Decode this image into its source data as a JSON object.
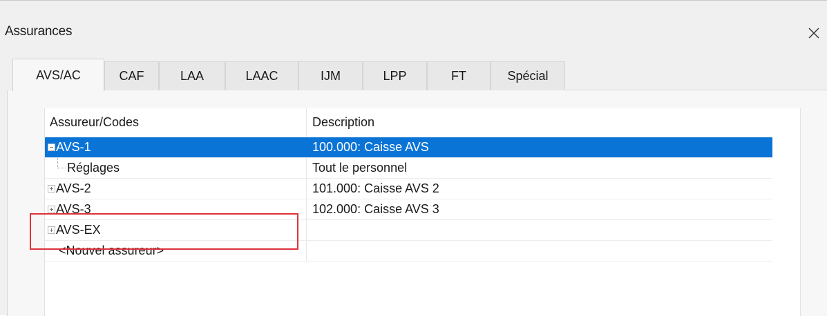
{
  "window": {
    "title": "Assurances",
    "close_icon": "close-icon"
  },
  "tabs": [
    {
      "label": "AVS/AC",
      "active": true
    },
    {
      "label": "CAF",
      "active": false
    },
    {
      "label": "LAA",
      "active": false
    },
    {
      "label": "LAAC",
      "active": false
    },
    {
      "label": "IJM",
      "active": false
    },
    {
      "label": "LPP",
      "active": false
    },
    {
      "label": "FT",
      "active": false
    },
    {
      "label": "Spécial",
      "active": false
    }
  ],
  "tree": {
    "columns": [
      "Assureur/Codes",
      "Description"
    ],
    "rows": [
      {
        "code": "AVS-1",
        "description": "100.000: Caisse AVS",
        "expander": "minus",
        "selected": true
      },
      {
        "code": "Réglages",
        "description": "Tout le personnel",
        "expander": "none",
        "selected": false
      },
      {
        "code": "AVS-2",
        "description": "101.000: Caisse AVS 2",
        "expander": "plus",
        "selected": false
      },
      {
        "code": "AVS-3",
        "description": "102.000: Caisse AVS 3",
        "expander": "plus",
        "selected": false
      },
      {
        "code": "AVS-EX",
        "description": "",
        "expander": "plus",
        "selected": false
      },
      {
        "code": "<Nouvel assureur>",
        "description": "",
        "expander": "none",
        "selected": false
      }
    ]
  },
  "colors": {
    "selection": "#0a74d6",
    "highlight_box": "#e0303a"
  }
}
